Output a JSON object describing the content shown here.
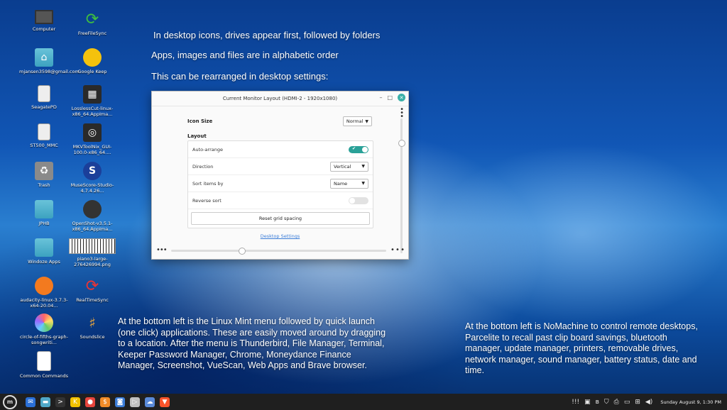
{
  "desktop_icons": [
    {
      "label": "Computer",
      "icon": "computer-icon"
    },
    {
      "label": "FreeFileSync",
      "icon": "freefilesync-icon"
    },
    {
      "label": "mjansen3598@gmail.com",
      "icon": "home-folder-icon"
    },
    {
      "label": "Google Keep",
      "icon": "google-keep-icon"
    },
    {
      "label": "SeagatePD",
      "icon": "drive-icon"
    },
    {
      "label": "LosslessCut-linux-x86_64.AppIma...",
      "icon": "losslesscut-icon"
    },
    {
      "label": "ST500_MMC",
      "icon": "drive-icon"
    },
    {
      "label": "MKVToolNix_GUI-100.0-x86_64....",
      "icon": "mkvtoolnix-icon"
    },
    {
      "label": "Trash",
      "icon": "trash-icon"
    },
    {
      "label": "MuseScore-Studio-4.7.4.26...",
      "icon": "musescore-icon"
    },
    {
      "label": "JPHB",
      "icon": "folder-icon"
    },
    {
      "label": "OpenShot-v3.5.1-x86_64.AppIma...",
      "icon": "openshot-icon"
    },
    {
      "label": "Windoze Apps",
      "icon": "folder-icon"
    },
    {
      "label": "piano3-large-276426994.png",
      "icon": "image-file-icon"
    },
    {
      "label": "audacity-linux-3.7.3-x64-20.04...",
      "icon": "audacity-icon"
    },
    {
      "label": "RealTimeSync",
      "icon": "realtimesync-icon"
    },
    {
      "label": "circle-of-fifths-graph-songwriti...",
      "icon": "circle-of-fifths-icon"
    },
    {
      "label": "Soundslice",
      "icon": "soundslice-icon"
    },
    {
      "label": "Common Commands",
      "icon": "document-icon"
    }
  ],
  "notes": {
    "n1": "In desktop icons, drives appear first, followed by folders",
    "n2": "Apps, images and files are in alphabetic order",
    "n3": "This can be rearranged in desktop settings:",
    "n4": "At the bottom left is the Linux Mint menu followed by quick launch (one click) applications. These are easily moved around by dragging to a location. After the menu is Thunderbird, File Manager, Terminal, Keeper Password Manager, Chrome, Moneydance Finance Manager, Screenshot, VueScan, Web Apps and Brave browser.",
    "n5": "At the bottom left is NoMachine to control remote desktops, Parcelite to recall past clip board savings, bluetooth manager, update manager, printers, removable drives, network manager, sound manager, battery status, date and time."
  },
  "dialog": {
    "title": "Current Monitor Layout (HDMI-2 - 1920x1080)",
    "icon_size_label": "Icon Size",
    "icon_size_value": "Normal",
    "layout_label": "Layout",
    "auto_arrange_label": "Auto-arrange",
    "auto_arrange_on": true,
    "direction_label": "Direction",
    "direction_value": "Vertical",
    "sort_label": "Sort items by",
    "sort_value": "Name",
    "reverse_label": "Reverse sort",
    "reverse_on": false,
    "reset_label": "Reset grid spacing",
    "settings_link": "Desktop Settings"
  },
  "panel": {
    "menu_icon": "linux-mint-menu-icon",
    "launchers": [
      {
        "name": "thunderbird",
        "color": "#2a6fd6",
        "glyph": "✉"
      },
      {
        "name": "file-manager",
        "color": "#4fa8c8",
        "glyph": "▬"
      },
      {
        "name": "terminal",
        "color": "#333333",
        "glyph": ">"
      },
      {
        "name": "keeper",
        "color": "#f2c200",
        "glyph": "K"
      },
      {
        "name": "chrome",
        "color": "#e8453c",
        "glyph": "●"
      },
      {
        "name": "moneydance",
        "color": "#f28c28",
        "glyph": "$"
      },
      {
        "name": "screenshot",
        "color": "#3b7dd8",
        "glyph": "◙"
      },
      {
        "name": "vuescan",
        "color": "#c0c0c0",
        "glyph": "▷"
      },
      {
        "name": "web-apps",
        "color": "#5a8ad8",
        "glyph": "☁"
      },
      {
        "name": "brave",
        "color": "#fb542b",
        "glyph": "▼"
      }
    ],
    "tray": [
      "nomachine-icon",
      "parcelite-icon",
      "bluetooth-icon",
      "update-manager-icon",
      "printer-icon",
      "removable-drive-icon",
      "network-icon",
      "volume-icon"
    ],
    "clock": "Sunday August 9, 1:30 PM"
  }
}
